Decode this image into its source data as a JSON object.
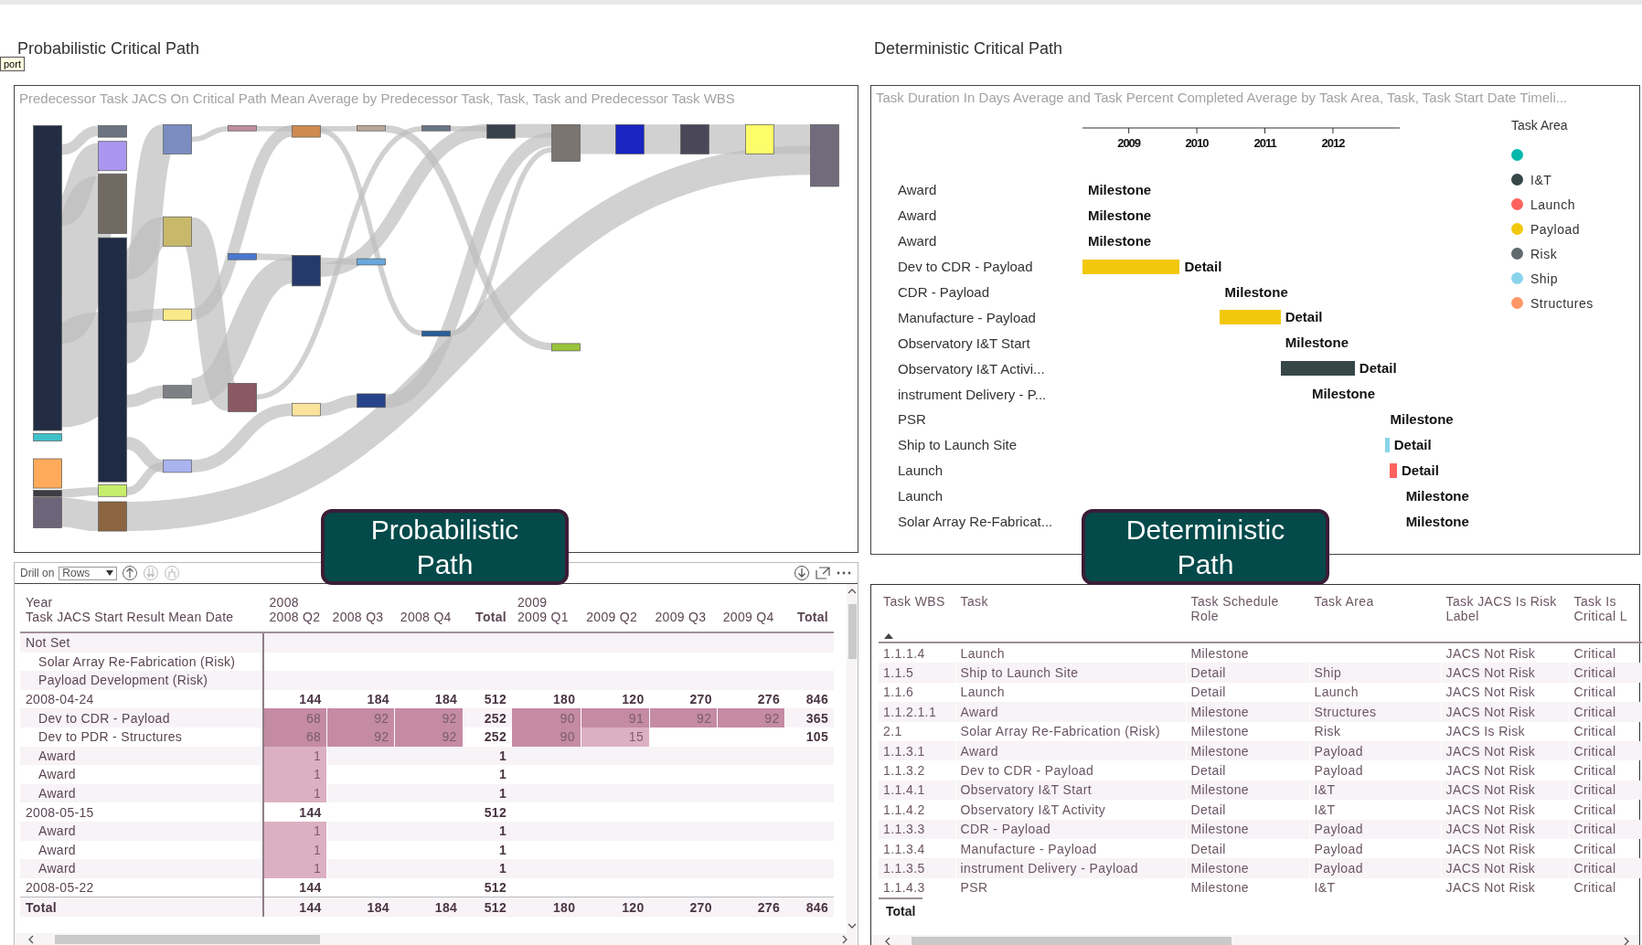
{
  "tooltip": "port",
  "probabilistic": {
    "title": "Probabilistic Critical Path",
    "sankey": {
      "title": "Predecessor Task JACS On Critical Path Mean Average by Predecessor Task, Task, Task and Predecessor Task WBS"
    },
    "badge": "Probabilistic Path",
    "matrix": {
      "drill_label": "Drill on",
      "drill_value": "Rows",
      "row_headers": [
        "Year",
        "Task JACS Start Result Mean Date"
      ],
      "years": [
        {
          "label": "2008",
          "columns": [
            {
              "label": "2008 Q2",
              "kind": "quarter"
            },
            {
              "label": "2008 Q3",
              "kind": "quarter"
            },
            {
              "label": "2008 Q4",
              "kind": "quarter"
            },
            {
              "label": "Total",
              "kind": "total"
            }
          ]
        },
        {
          "label": "2009",
          "columns": [
            {
              "label": "2009 Q1",
              "kind": "quarter"
            },
            {
              "label": "2009 Q2",
              "kind": "quarter"
            },
            {
              "label": "2009 Q3",
              "kind": "quarter"
            },
            {
              "label": "2009 Q4",
              "kind": "quarter"
            },
            {
              "label": "Total",
              "kind": "total"
            }
          ]
        }
      ],
      "rows": [
        {
          "label": "Not Set",
          "children": [
            {
              "label": "Solar Array Re-Fabrication (Risk)"
            },
            {
              "label": "Payload Development (Risk)"
            }
          ]
        },
        {
          "label": "2008-04-24",
          "cells": [
            {
              "kind": "value",
              "value": "144"
            },
            {
              "kind": "value",
              "value": "184"
            },
            {
              "kind": "value",
              "value": "184"
            },
            {
              "kind": "value",
              "value": "512"
            },
            {
              "kind": "value",
              "value": "180"
            },
            {
              "kind": "value",
              "value": "120"
            },
            {
              "kind": "value",
              "value": "270"
            },
            {
              "kind": "value",
              "value": "276"
            },
            {
              "kind": "value",
              "value": "846"
            }
          ],
          "children": [
            {
              "label": "Dev to CDR - Payload",
              "cells": [
                {
                  "kind": "heat",
                  "value": "68"
                },
                {
                  "kind": "heat",
                  "value": "92"
                },
                {
                  "kind": "heat",
                  "value": "92"
                },
                {
                  "kind": "value",
                  "value": "252"
                },
                {
                  "kind": "heat",
                  "value": "90"
                },
                {
                  "kind": "heat",
                  "value": "91"
                },
                {
                  "kind": "heat",
                  "value": "92"
                },
                {
                  "kind": "heat",
                  "value": "92"
                },
                {
                  "kind": "value",
                  "value": "365"
                }
              ]
            },
            {
              "label": "Dev to PDR - Structures",
              "cells": [
                {
                  "kind": "heat",
                  "value": "68"
                },
                {
                  "kind": "heat",
                  "value": "92"
                },
                {
                  "kind": "heat",
                  "value": "92"
                },
                {
                  "kind": "value",
                  "value": "252"
                },
                {
                  "kind": "heat",
                  "value": "90"
                },
                {
                  "kind": "heat",
                  "value": "15"
                },
                {
                  "kind": "blank"
                },
                {
                  "kind": "blank"
                },
                {
                  "kind": "value",
                  "value": "105"
                }
              ]
            },
            {
              "label": "Award",
              "cells": [
                {
                  "kind": "heat",
                  "value": "1"
                },
                {
                  "kind": "blank"
                },
                {
                  "kind": "blank"
                },
                {
                  "kind": "value",
                  "value": "1"
                }
              ]
            },
            {
              "label": "Award",
              "cells": [
                {
                  "kind": "heat",
                  "value": "1"
                },
                {
                  "kind": "blank"
                },
                {
                  "kind": "blank"
                },
                {
                  "kind": "value",
                  "value": "1"
                }
              ]
            },
            {
              "label": "Award",
              "cells": [
                {
                  "kind": "heat",
                  "value": "1"
                },
                {
                  "kind": "blank"
                },
                {
                  "kind": "blank"
                },
                {
                  "kind": "value",
                  "value": "1"
                }
              ]
            }
          ]
        },
        {
          "label": "2008-05-15",
          "cells": [
            {
              "kind": "value",
              "value": "144"
            },
            {
              "kind": "blank"
            },
            {
              "kind": "blank"
            },
            {
              "kind": "value",
              "value": "512"
            }
          ],
          "children": [
            {
              "label": "Award",
              "cells": [
                {
                  "kind": "heat",
                  "value": "1"
                },
                {
                  "kind": "blank"
                },
                {
                  "kind": "blank"
                },
                {
                  "kind": "value",
                  "value": "1"
                }
              ]
            },
            {
              "label": "Award",
              "cells": [
                {
                  "kind": "heat",
                  "value": "1"
                },
                {
                  "kind": "blank"
                },
                {
                  "kind": "blank"
                },
                {
                  "kind": "value",
                  "value": "1"
                }
              ]
            },
            {
              "label": "Award",
              "cells": [
                {
                  "kind": "heat",
                  "value": "1"
                },
                {
                  "kind": "blank"
                },
                {
                  "kind": "blank"
                },
                {
                  "kind": "value",
                  "value": "1"
                }
              ]
            }
          ]
        },
        {
          "label": "2008-05-22",
          "cells": [
            {
              "kind": "value",
              "value": "144"
            },
            {
              "kind": "blank"
            },
            {
              "kind": "blank"
            },
            {
              "kind": "value",
              "value": "512"
            }
          ]
        }
      ],
      "total": {
        "label": "Total",
        "cells": [
          {
            "kind": "value",
            "value": "144"
          },
          {
            "kind": "value",
            "value": "184"
          },
          {
            "kind": "value",
            "value": "184"
          },
          {
            "kind": "value",
            "value": "512"
          },
          {
            "kind": "value",
            "value": "180"
          },
          {
            "kind": "value",
            "value": "120"
          },
          {
            "kind": "value",
            "value": "270"
          },
          {
            "kind": "value",
            "value": "276"
          },
          {
            "kind": "value",
            "value": "846"
          }
        ]
      }
    }
  },
  "deterministic": {
    "title": "Deterministic Critical Path",
    "badge": "Deterministic Path",
    "gantt": {
      "title": "Task Duration In Days Average and Task Percent Completed Average by Task Area, Task, Task Start Date Timeli...",
      "axis_ticks": [
        "2009",
        "2010",
        "2011",
        "2012"
      ],
      "rows": [
        {
          "task": "Award",
          "role": "Milestone",
          "kind": "milestone"
        },
        {
          "task": "Award",
          "role": "Milestone",
          "kind": "milestone"
        },
        {
          "task": "Award",
          "role": "Milestone",
          "kind": "milestone"
        },
        {
          "task": "Dev to CDR - Payload",
          "role": "Detail",
          "kind": "detail",
          "color": "#f2c80f"
        },
        {
          "task": "CDR - Payload",
          "role": "Milestone",
          "kind": "milestone"
        },
        {
          "task": "Manufacture - Payload",
          "role": "Detail",
          "kind": "detail",
          "color": "#f2c80f"
        },
        {
          "task": "Observatory I&T Start",
          "role": "Milestone",
          "kind": "milestone"
        },
        {
          "task": "Observatory I&T Activi...",
          "role": "Detail",
          "kind": "detail",
          "color": "#374649"
        },
        {
          "task": "instrument Delivery - P...",
          "role": "Milestone",
          "kind": "milestone"
        },
        {
          "task": "PSR",
          "role": "Milestone",
          "kind": "milestone"
        },
        {
          "task": "Ship to Launch Site",
          "role": "Detail",
          "kind": "detail",
          "color": "#8ad4eb"
        },
        {
          "task": "Launch",
          "role": "Detail",
          "kind": "detail",
          "color": "#fd625e"
        },
        {
          "task": "Launch",
          "role": "Milestone",
          "kind": "milestone"
        },
        {
          "task": "Solar Array Re-Fabricat...",
          "role": "Milestone",
          "kind": "milestone"
        }
      ],
      "legend": {
        "title": "Task Area",
        "items": [
          {
            "color": "#01b8aa"
          },
          {
            "label": "I&T",
            "color": "#374649"
          },
          {
            "label": "Launch",
            "color": "#fd625e"
          },
          {
            "label": "Payload",
            "color": "#f2c80f"
          },
          {
            "label": "Risk",
            "color": "#5f6b6d"
          },
          {
            "label": "Ship",
            "color": "#8ad4eb"
          },
          {
            "label": "Structures",
            "color": "#fe9666"
          }
        ]
      }
    },
    "table": {
      "columns": [
        {
          "label": "Task WBS",
          "sorted": true
        },
        {
          "label": "Task",
          "sorted": false
        },
        {
          "label": "Task Schedule Role",
          "sorted": false
        },
        {
          "label": "Task Area",
          "sorted": false
        },
        {
          "label": "Task JACS Is Risk Label",
          "sorted": false
        },
        {
          "label": "Task Is Critical L",
          "sorted": false
        }
      ],
      "rows": [
        {
          "wbs": "1.1.1.4",
          "task": "Launch",
          "role": "Milestone",
          "risk": "JACS Not Risk",
          "critical": "Critical"
        },
        {
          "wbs": "1.1.5",
          "task": "Ship to Launch Site",
          "role": "Detail",
          "area": "Ship",
          "risk": "JACS Not Risk",
          "critical": "Critical"
        },
        {
          "wbs": "1.1.6",
          "task": "Launch",
          "role": "Detail",
          "area": "Launch",
          "risk": "JACS Not Risk",
          "critical": "Critical"
        },
        {
          "wbs": "1.1.2.1.1",
          "task": "Award",
          "role": "Milestone",
          "area": "Structures",
          "risk": "JACS Not Risk",
          "critical": "Critical"
        },
        {
          "wbs": "2.1",
          "task": "Solar Array Re-Fabrication (Risk)",
          "role": "Milestone",
          "area": "Risk",
          "risk": "JACS Is Risk",
          "critical": "Critical"
        },
        {
          "wbs": "1.1.3.1",
          "task": "Award",
          "role": "Milestone",
          "area": "Payload",
          "risk": "JACS Not Risk",
          "critical": "Critical"
        },
        {
          "wbs": "1.1.3.2",
          "task": "Dev to CDR - Payload",
          "role": "Detail",
          "area": "Payload",
          "risk": "JACS Not Risk",
          "critical": "Critical"
        },
        {
          "wbs": "1.1.4.1",
          "task": "Observatory I&T Start",
          "role": "Milestone",
          "area": "I&T",
          "risk": "JACS Not Risk",
          "critical": "Critical"
        },
        {
          "wbs": "1.1.4.2",
          "task": "Observatory I&T Activity",
          "role": "Detail",
          "area": "I&T",
          "risk": "JACS Not Risk",
          "critical": "Critical"
        },
        {
          "wbs": "1.1.3.3",
          "task": "CDR - Payload",
          "role": "Milestone",
          "area": "Payload",
          "risk": "JACS Not Risk",
          "critical": "Critical"
        },
        {
          "wbs": "1.1.3.4",
          "task": "Manufacture - Payload",
          "role": "Detail",
          "area": "Payload",
          "risk": "JACS Not Risk",
          "critical": "Critical"
        },
        {
          "wbs": "1.1.3.5",
          "task": "instrument Delivery - Payload",
          "role": "Milestone",
          "area": "Payload",
          "risk": "JACS Not Risk",
          "critical": "Critical"
        },
        {
          "wbs": "1.1.4.3",
          "task": "PSR",
          "role": "Milestone",
          "area": "I&T",
          "risk": "JACS Not Risk",
          "critical": "Critical"
        }
      ],
      "total": "Total"
    }
  }
}
